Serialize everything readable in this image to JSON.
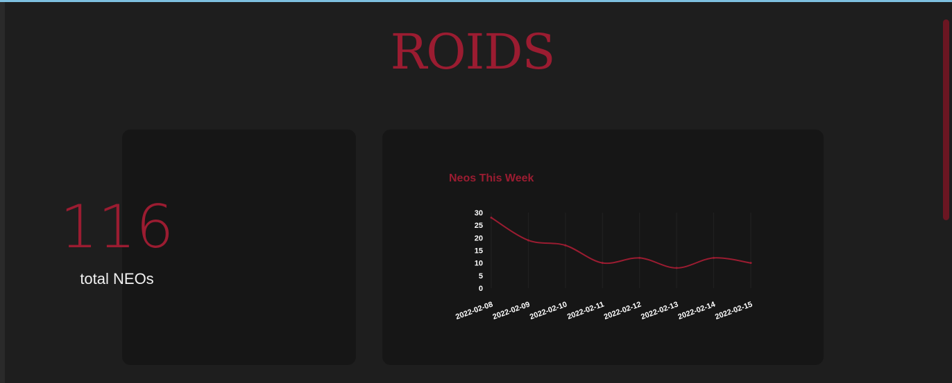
{
  "header": {
    "title": "ROIDS"
  },
  "stat": {
    "value": "116",
    "label": "total NEOs"
  },
  "colors": {
    "accent": "#9b1c31",
    "background": "#1e1e1e",
    "card": "#161616",
    "top_bar": "#7ec0e0"
  },
  "chart_data": {
    "type": "line",
    "title": "Neos This Week",
    "xlabel": "",
    "ylabel": "",
    "categories": [
      "2022-02-08",
      "2022-02-09",
      "2022-02-10",
      "2022-02-11",
      "2022-02-12",
      "2022-02-13",
      "2022-02-14",
      "2022-02-15"
    ],
    "series": [
      {
        "values": [
          28,
          19,
          17,
          10,
          12,
          8,
          12,
          10
        ]
      }
    ],
    "yticks": [
      0,
      5,
      10,
      15,
      20,
      25,
      30
    ],
    "ylim": [
      0,
      30
    ],
    "grid": true,
    "legend": "none"
  }
}
